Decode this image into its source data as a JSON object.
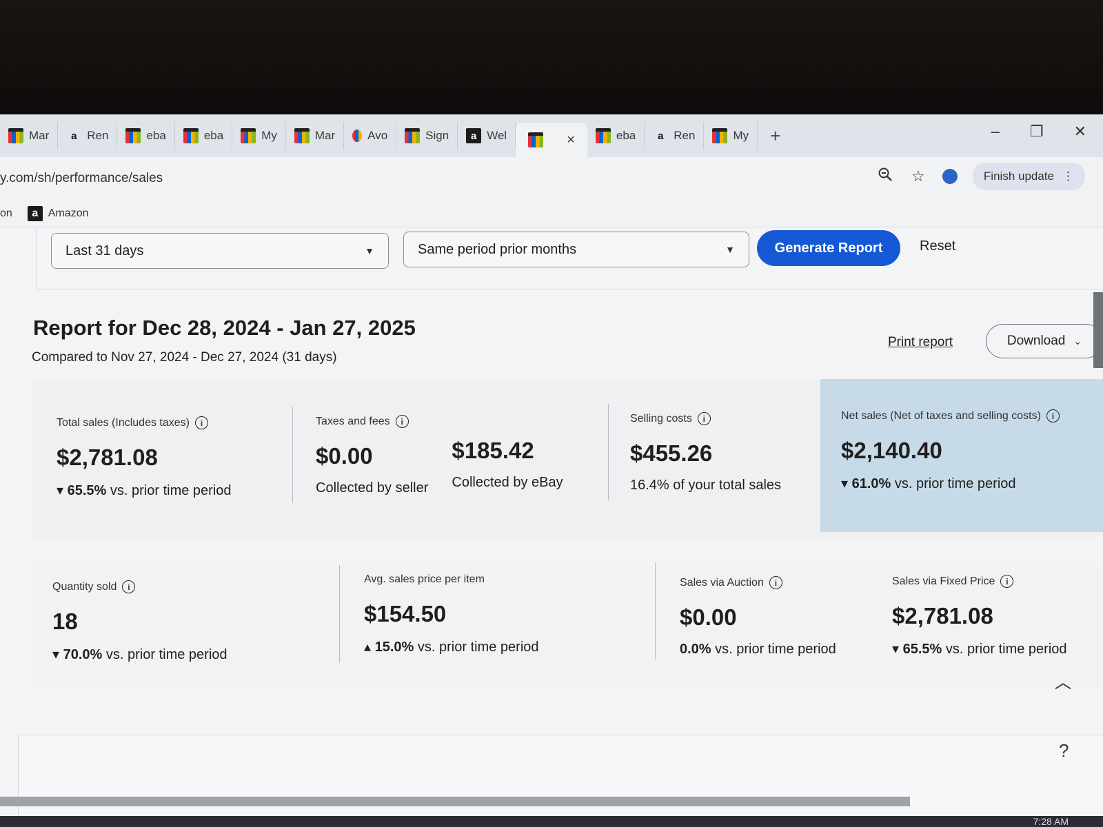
{
  "browser": {
    "tabs": [
      {
        "icon": "ebay-bag-icon",
        "label": "Mar"
      },
      {
        "icon": "amazon-a-icon",
        "label": "Ren"
      },
      {
        "icon": "ebay-bag-icon",
        "label": "eba"
      },
      {
        "icon": "ebay-bag-icon",
        "label": "eba"
      },
      {
        "icon": "ebay-bag-icon",
        "label": "My"
      },
      {
        "icon": "ebay-bag-icon",
        "label": "Mar"
      },
      {
        "icon": "avo-icon",
        "label": "Avo"
      },
      {
        "icon": "ebay-bag-icon",
        "label": "Sign"
      },
      {
        "icon": "amazon-box-icon",
        "label": "Wel"
      },
      {
        "icon": "ebay-bag-icon",
        "label": "",
        "active": true
      },
      {
        "icon": "ebay-bag-icon",
        "label": "eba"
      },
      {
        "icon": "amazon-a-icon",
        "label": "Ren"
      },
      {
        "icon": "ebay-bag-icon",
        "label": "My"
      }
    ],
    "new_tab": "+",
    "close_tab": "×",
    "url": "y.com/sh/performance/sales",
    "finish_update": "Finish update",
    "bookmarks": [
      {
        "label": "on"
      },
      {
        "label": "Amazon"
      }
    ]
  },
  "filters": {
    "period": "Last 31 days",
    "comparison": "Same period prior months",
    "generate": "Generate Report",
    "reset": "Reset"
  },
  "report": {
    "title": "Report for Dec 28, 2024 - Jan 27, 2025",
    "subtitle": "Compared to Nov 27, 2024 - Dec 27, 2024 (31 days)",
    "print": "Print report",
    "download": "Download"
  },
  "metrics": {
    "total_sales": {
      "label": "Total sales (Includes taxes)",
      "value": "$2,781.08",
      "change": "65.5%",
      "suffix": "vs. prior time period",
      "direction": "down"
    },
    "taxes_fees": {
      "label": "Taxes and fees",
      "seller_value": "$0.00",
      "seller_caption": "Collected by seller",
      "ebay_value": "$185.42",
      "ebay_caption": "Collected by eBay"
    },
    "selling_costs": {
      "label": "Selling costs",
      "value": "$455.26",
      "caption": "16.4% of your total sales"
    },
    "net_sales": {
      "label": "Net sales (Net of taxes and selling costs)",
      "value": "$2,140.40",
      "change": "61.0%",
      "suffix": "vs. prior time period",
      "direction": "down"
    },
    "quantity_sold": {
      "label": "Quantity sold",
      "value": "18",
      "change": "70.0%",
      "suffix": "vs. prior time period",
      "direction": "down"
    },
    "avg_price": {
      "label": "Avg. sales price per item",
      "value": "$154.50",
      "change": "15.0%",
      "suffix": "vs. prior time period",
      "direction": "up"
    },
    "auction": {
      "label": "Sales via Auction",
      "value": "$0.00",
      "change": "0.0%",
      "suffix": "vs. prior time period"
    },
    "fixed_price": {
      "label": "Sales via Fixed Price",
      "value": "$2,781.08",
      "change": "65.5%",
      "suffix": "vs. prior time period",
      "direction": "down"
    }
  },
  "help": "?",
  "clock": "7:28 AM"
}
